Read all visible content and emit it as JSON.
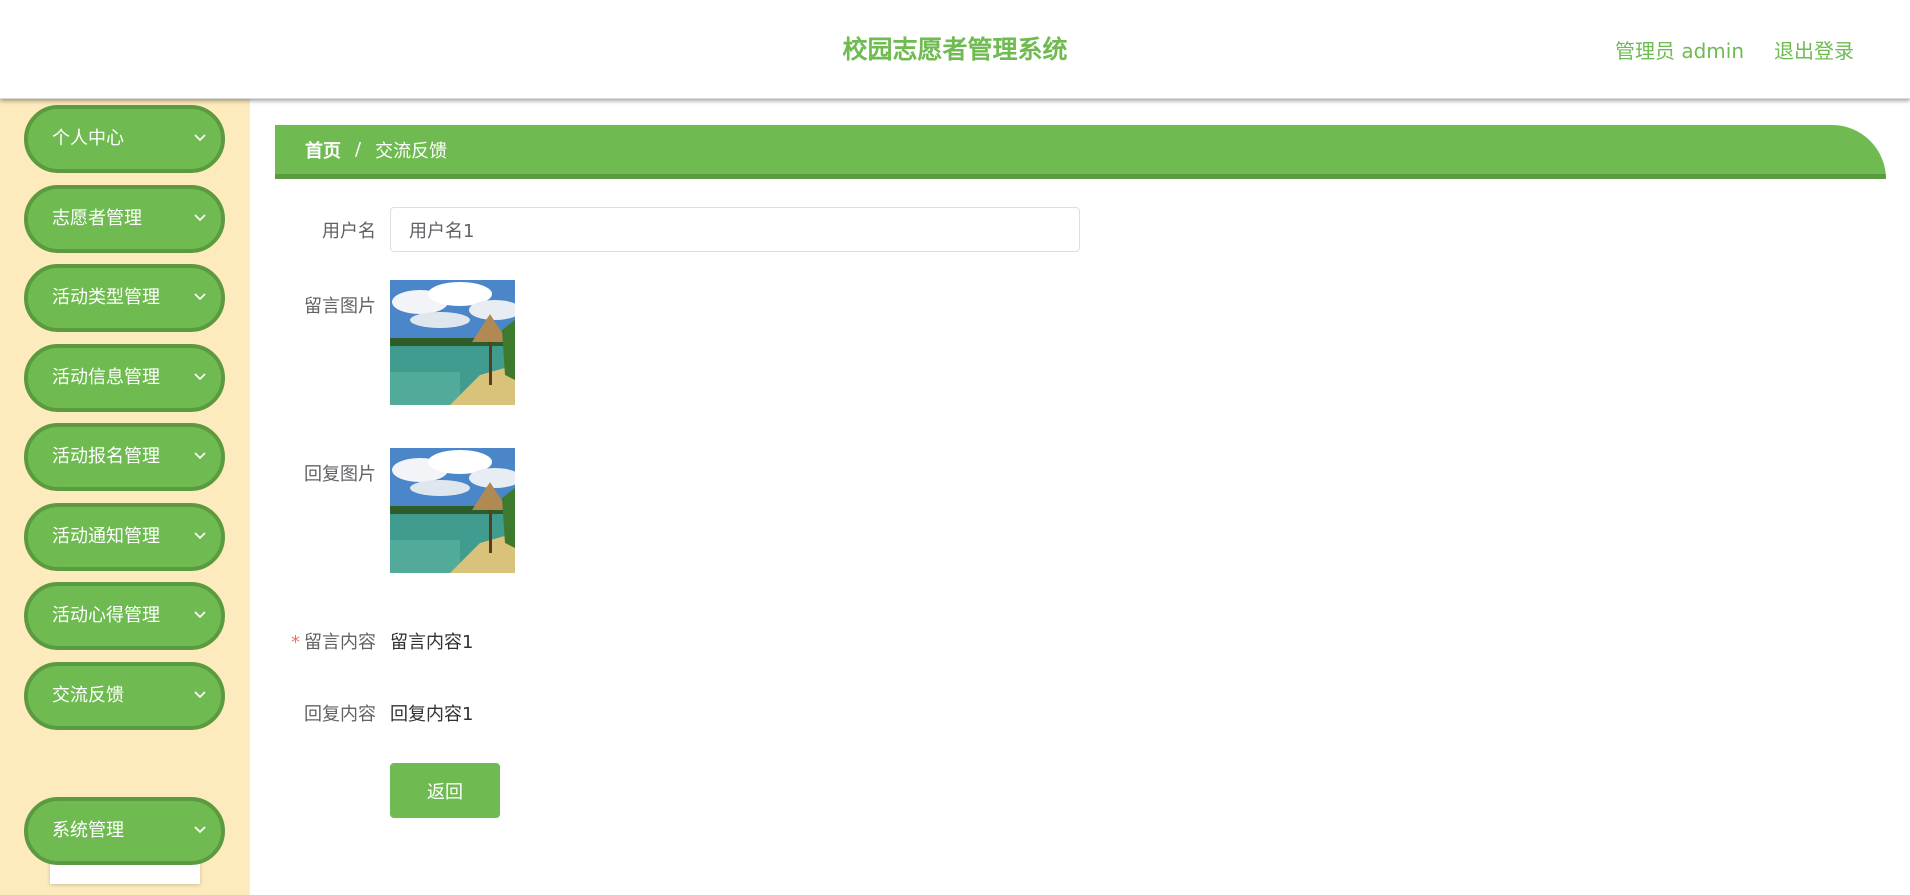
{
  "header": {
    "title": "校园志愿者管理系统",
    "user_label": "管理员 admin",
    "logout_label": "退出登录"
  },
  "sidebar": {
    "items": [
      {
        "label": "个人中心"
      },
      {
        "label": "志愿者管理"
      },
      {
        "label": "活动类型管理"
      },
      {
        "label": "活动信息管理"
      },
      {
        "label": "活动报名管理"
      },
      {
        "label": "活动通知管理"
      },
      {
        "label": "活动心得管理"
      },
      {
        "label": "交流反馈"
      },
      {
        "label": "系统管理"
      }
    ],
    "submenu": {
      "label": "交流反馈"
    }
  },
  "breadcrumb": {
    "home": "首页",
    "separator": "/",
    "current": "交流反馈"
  },
  "form": {
    "username": {
      "label": "用户名",
      "value": "用户名1"
    },
    "message_image": {
      "label": "留言图片"
    },
    "reply_image": {
      "label": "回复图片"
    },
    "message_content": {
      "required_mark": "*",
      "label": "留言内容",
      "value": "留言内容1"
    },
    "reply_content": {
      "label": "回复内容",
      "value": "回复内容1"
    },
    "back_button": "返回"
  },
  "colors": {
    "accent": "#6fbb52",
    "accent_dark": "#5b9a3f",
    "sidebar_bg": "#fdebbd",
    "required": "#f56c6c"
  }
}
